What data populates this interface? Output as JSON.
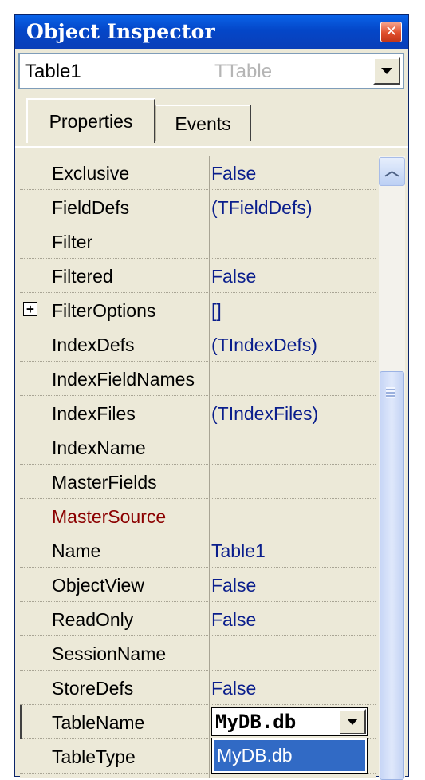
{
  "window": {
    "title": "Object Inspector"
  },
  "component_selector": {
    "name": "Table1",
    "type": "TTable"
  },
  "tabs": [
    {
      "label": "Properties",
      "active": true
    },
    {
      "label": "Events",
      "active": false
    }
  ],
  "properties": [
    {
      "name": "Exclusive",
      "value": "False"
    },
    {
      "name": "FieldDefs",
      "value": "(TFieldDefs)"
    },
    {
      "name": "Filter",
      "value": ""
    },
    {
      "name": "Filtered",
      "value": "False"
    },
    {
      "name": "FilterOptions",
      "value": "[]",
      "expandable": true,
      "expander": "+"
    },
    {
      "name": "IndexDefs",
      "value": "(TIndexDefs)"
    },
    {
      "name": "IndexFieldNames",
      "value": ""
    },
    {
      "name": "IndexFiles",
      "value": "(TIndexFiles)"
    },
    {
      "name": "IndexName",
      "value": ""
    },
    {
      "name": "MasterFields",
      "value": ""
    },
    {
      "name": "MasterSource",
      "value": "",
      "color": "#8b0000"
    },
    {
      "name": "Name",
      "value": "Table1"
    },
    {
      "name": "ObjectView",
      "value": "False"
    },
    {
      "name": "ReadOnly",
      "value": "False"
    },
    {
      "name": "SessionName",
      "value": ""
    },
    {
      "name": "StoreDefs",
      "value": "False"
    },
    {
      "name": "TableName",
      "value": "MyDB.db",
      "editing": true
    },
    {
      "name": "TableType",
      "value": ""
    }
  ],
  "dropdown": {
    "options": [
      "MyDB.db"
    ],
    "selected": "MyDB.db"
  },
  "icons": {
    "close": "close-icon",
    "combo_arrow": "chevron-down-icon",
    "scroll_up": "chevron-up-icon"
  },
  "colors": {
    "titlebar": "#0446c8",
    "selection": "#316ac5",
    "value_text": "#0a1e8c"
  }
}
